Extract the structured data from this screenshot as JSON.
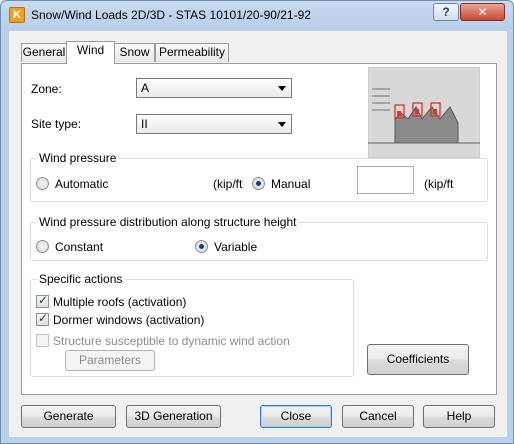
{
  "window": {
    "title": "Snow/Wind Loads 2D/3D - STAS 10101/20-90/21-92",
    "help_button": "?",
    "close_button": "✕",
    "app_icon_letter": "K"
  },
  "tabs": [
    {
      "label": "General",
      "active": false
    },
    {
      "label": "Wind",
      "active": true
    },
    {
      "label": "Snow",
      "active": false
    },
    {
      "label": "Permeability",
      "active": false
    }
  ],
  "wind_tab": {
    "zone": {
      "label": "Zone:",
      "value": "A"
    },
    "site_type": {
      "label": "Site type:",
      "value": "II"
    },
    "wind_pressure": {
      "title": "Wind pressure",
      "automatic_label": "Automatic",
      "automatic_unit": "(kip/ft",
      "manual_label": "Manual",
      "manual_value": "",
      "manual_unit": "(kip/ft",
      "selected": "manual"
    },
    "distribution": {
      "title": "Wind pressure distribution along structure height",
      "constant_label": "Constant",
      "variable_label": "Variable",
      "selected": "variable"
    },
    "specific_actions": {
      "title": "Specific actions",
      "multiple_roofs": {
        "label": "Multiple roofs (activation)",
        "checked": true
      },
      "dormer_windows": {
        "label": "Dormer windows (activation)",
        "checked": true
      },
      "dynamic": {
        "label": "Structure susceptible to dynamic wind action",
        "checked": false,
        "disabled": true
      },
      "parameters_button": "Parameters"
    },
    "coefficients_button": "Coefficients",
    "preview_icon": "wind-on-structure-diagram"
  },
  "footer": {
    "generate": "Generate",
    "generation_3d": "3D Generation",
    "close": "Close",
    "cancel": "Cancel",
    "help": "Help"
  },
  "colors": {
    "title_bar": "#b9d1ea",
    "close_button": "#c54a32",
    "radio_check": "#1e3c6e",
    "preview_highlight": "#e03030"
  }
}
